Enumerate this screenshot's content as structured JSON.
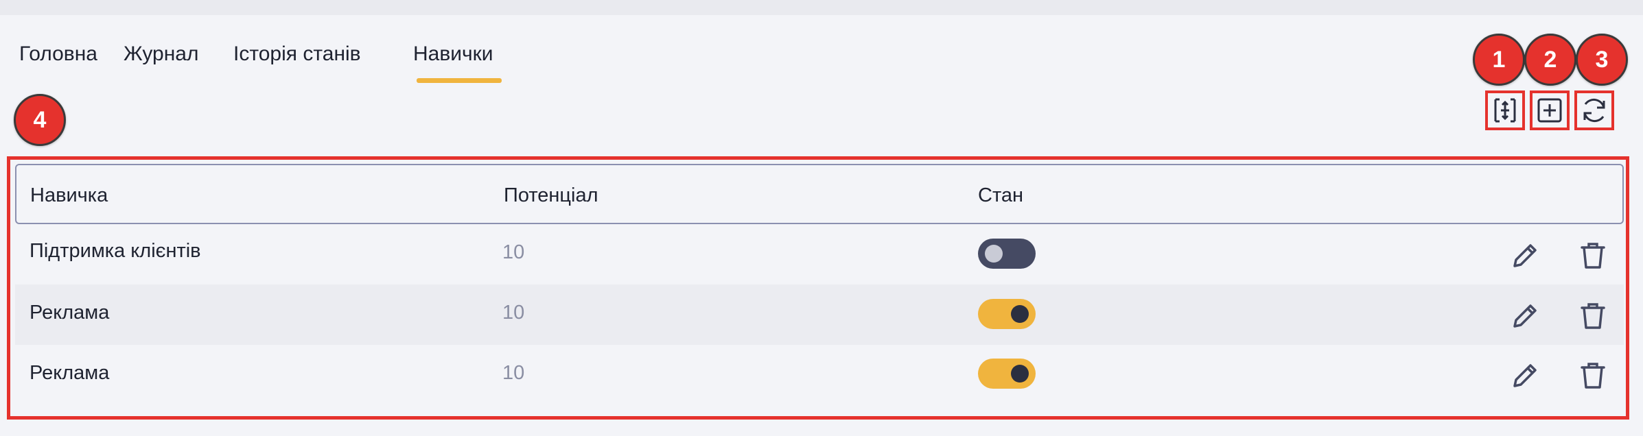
{
  "tabs": [
    {
      "label": "Головна"
    },
    {
      "label": "Журнал"
    },
    {
      "label": "Історія станів"
    },
    {
      "label": "Навички",
      "active": true
    }
  ],
  "accent_color": "#f0b43e",
  "marker_color": "#e5322d",
  "markers": {
    "m1": "1",
    "m2": "2",
    "m3": "3",
    "m4": "4"
  },
  "toolbar": {
    "icons": [
      "expand-icon",
      "add-icon",
      "refresh-icon"
    ]
  },
  "table": {
    "columns": {
      "skill": "Навичка",
      "potential": "Потенціал",
      "state": "Стан"
    },
    "rows": [
      {
        "name": "Підтримка клієнтів",
        "potential": "10",
        "state_on": false
      },
      {
        "name": "Реклама",
        "potential": "10",
        "state_on": true
      },
      {
        "name": "Реклама",
        "potential": "10",
        "state_on": true
      }
    ]
  }
}
